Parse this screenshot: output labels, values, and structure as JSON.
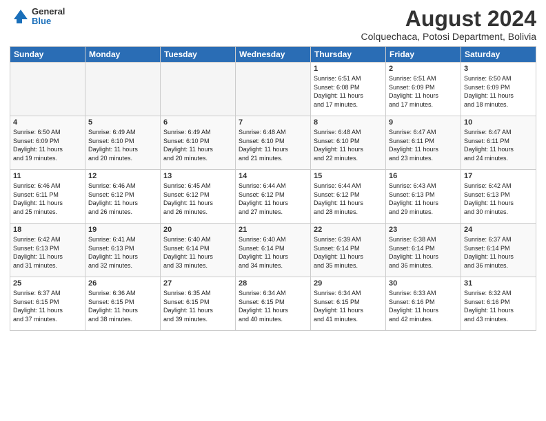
{
  "header": {
    "logo": {
      "general": "General",
      "blue": "Blue"
    },
    "title": "August 2024",
    "location": "Colquechaca, Potosi Department, Bolivia"
  },
  "days_of_week": [
    "Sunday",
    "Monday",
    "Tuesday",
    "Wednesday",
    "Thursday",
    "Friday",
    "Saturday"
  ],
  "weeks": [
    [
      {
        "day": "",
        "info": ""
      },
      {
        "day": "",
        "info": ""
      },
      {
        "day": "",
        "info": ""
      },
      {
        "day": "",
        "info": ""
      },
      {
        "day": "1",
        "info": "Sunrise: 6:51 AM\nSunset: 6:08 PM\nDaylight: 11 hours\nand 17 minutes."
      },
      {
        "day": "2",
        "info": "Sunrise: 6:51 AM\nSunset: 6:09 PM\nDaylight: 11 hours\nand 17 minutes."
      },
      {
        "day": "3",
        "info": "Sunrise: 6:50 AM\nSunset: 6:09 PM\nDaylight: 11 hours\nand 18 minutes."
      }
    ],
    [
      {
        "day": "4",
        "info": "Sunrise: 6:50 AM\nSunset: 6:09 PM\nDaylight: 11 hours\nand 19 minutes."
      },
      {
        "day": "5",
        "info": "Sunrise: 6:49 AM\nSunset: 6:10 PM\nDaylight: 11 hours\nand 20 minutes."
      },
      {
        "day": "6",
        "info": "Sunrise: 6:49 AM\nSunset: 6:10 PM\nDaylight: 11 hours\nand 20 minutes."
      },
      {
        "day": "7",
        "info": "Sunrise: 6:48 AM\nSunset: 6:10 PM\nDaylight: 11 hours\nand 21 minutes."
      },
      {
        "day": "8",
        "info": "Sunrise: 6:48 AM\nSunset: 6:10 PM\nDaylight: 11 hours\nand 22 minutes."
      },
      {
        "day": "9",
        "info": "Sunrise: 6:47 AM\nSunset: 6:11 PM\nDaylight: 11 hours\nand 23 minutes."
      },
      {
        "day": "10",
        "info": "Sunrise: 6:47 AM\nSunset: 6:11 PM\nDaylight: 11 hours\nand 24 minutes."
      }
    ],
    [
      {
        "day": "11",
        "info": "Sunrise: 6:46 AM\nSunset: 6:11 PM\nDaylight: 11 hours\nand 25 minutes."
      },
      {
        "day": "12",
        "info": "Sunrise: 6:46 AM\nSunset: 6:12 PM\nDaylight: 11 hours\nand 26 minutes."
      },
      {
        "day": "13",
        "info": "Sunrise: 6:45 AM\nSunset: 6:12 PM\nDaylight: 11 hours\nand 26 minutes."
      },
      {
        "day": "14",
        "info": "Sunrise: 6:44 AM\nSunset: 6:12 PM\nDaylight: 11 hours\nand 27 minutes."
      },
      {
        "day": "15",
        "info": "Sunrise: 6:44 AM\nSunset: 6:12 PM\nDaylight: 11 hours\nand 28 minutes."
      },
      {
        "day": "16",
        "info": "Sunrise: 6:43 AM\nSunset: 6:13 PM\nDaylight: 11 hours\nand 29 minutes."
      },
      {
        "day": "17",
        "info": "Sunrise: 6:42 AM\nSunset: 6:13 PM\nDaylight: 11 hours\nand 30 minutes."
      }
    ],
    [
      {
        "day": "18",
        "info": "Sunrise: 6:42 AM\nSunset: 6:13 PM\nDaylight: 11 hours\nand 31 minutes."
      },
      {
        "day": "19",
        "info": "Sunrise: 6:41 AM\nSunset: 6:13 PM\nDaylight: 11 hours\nand 32 minutes."
      },
      {
        "day": "20",
        "info": "Sunrise: 6:40 AM\nSunset: 6:14 PM\nDaylight: 11 hours\nand 33 minutes."
      },
      {
        "day": "21",
        "info": "Sunrise: 6:40 AM\nSunset: 6:14 PM\nDaylight: 11 hours\nand 34 minutes."
      },
      {
        "day": "22",
        "info": "Sunrise: 6:39 AM\nSunset: 6:14 PM\nDaylight: 11 hours\nand 35 minutes."
      },
      {
        "day": "23",
        "info": "Sunrise: 6:38 AM\nSunset: 6:14 PM\nDaylight: 11 hours\nand 36 minutes."
      },
      {
        "day": "24",
        "info": "Sunrise: 6:37 AM\nSunset: 6:14 PM\nDaylight: 11 hours\nand 36 minutes."
      }
    ],
    [
      {
        "day": "25",
        "info": "Sunrise: 6:37 AM\nSunset: 6:15 PM\nDaylight: 11 hours\nand 37 minutes."
      },
      {
        "day": "26",
        "info": "Sunrise: 6:36 AM\nSunset: 6:15 PM\nDaylight: 11 hours\nand 38 minutes."
      },
      {
        "day": "27",
        "info": "Sunrise: 6:35 AM\nSunset: 6:15 PM\nDaylight: 11 hours\nand 39 minutes."
      },
      {
        "day": "28",
        "info": "Sunrise: 6:34 AM\nSunset: 6:15 PM\nDaylight: 11 hours\nand 40 minutes."
      },
      {
        "day": "29",
        "info": "Sunrise: 6:34 AM\nSunset: 6:15 PM\nDaylight: 11 hours\nand 41 minutes."
      },
      {
        "day": "30",
        "info": "Sunrise: 6:33 AM\nSunset: 6:16 PM\nDaylight: 11 hours\nand 42 minutes."
      },
      {
        "day": "31",
        "info": "Sunrise: 6:32 AM\nSunset: 6:16 PM\nDaylight: 11 hours\nand 43 minutes."
      }
    ]
  ]
}
